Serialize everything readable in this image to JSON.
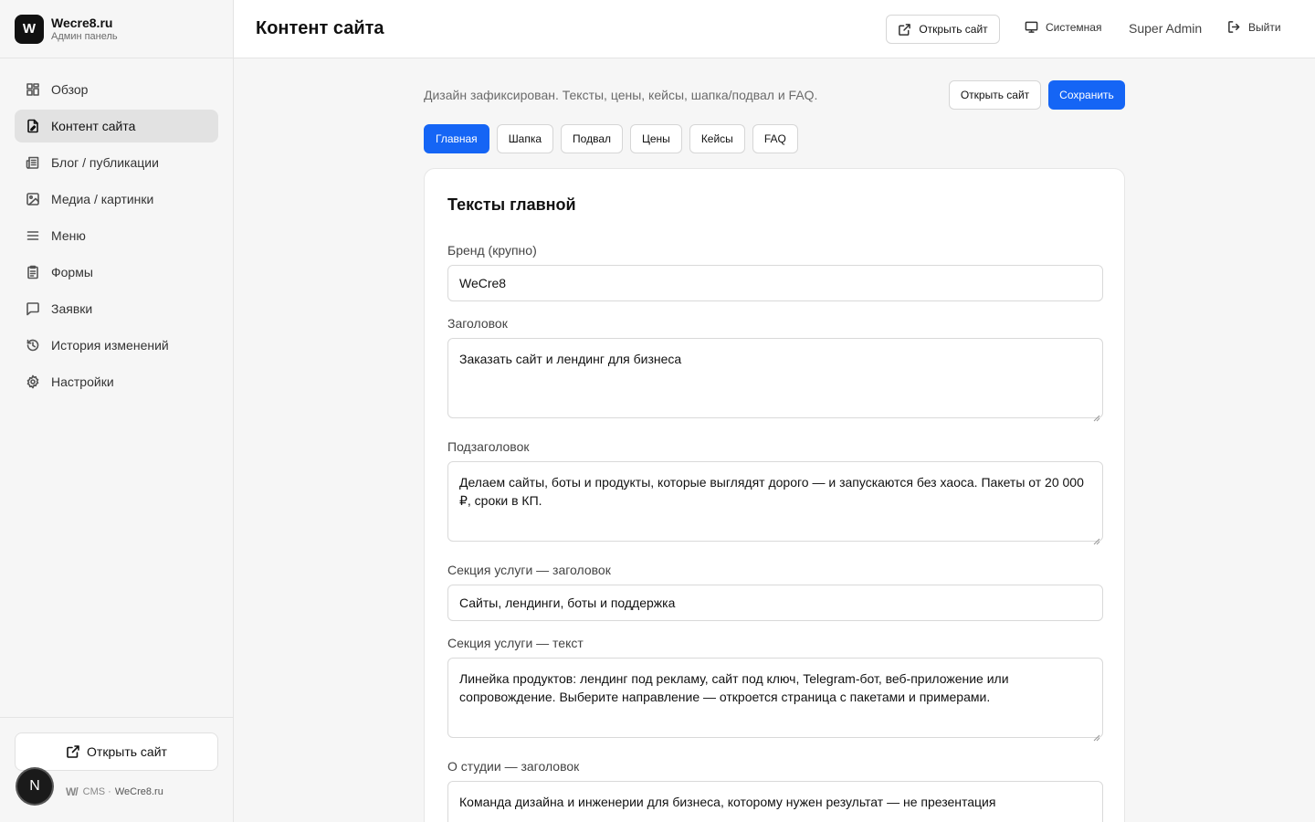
{
  "brand": {
    "logo_letter": "W",
    "name": "Wecre8.ru",
    "subtitle": "Админ панель"
  },
  "nav": [
    {
      "label": "Обзор",
      "icon": "dashboard-icon"
    },
    {
      "label": "Контент сайта",
      "icon": "file-edit-icon",
      "active": true
    },
    {
      "label": "Блог / публикации",
      "icon": "newspaper-icon"
    },
    {
      "label": "Медиа / картинки",
      "icon": "image-icon"
    },
    {
      "label": "Меню",
      "icon": "menu-icon"
    },
    {
      "label": "Формы",
      "icon": "clipboard-icon"
    },
    {
      "label": "Заявки",
      "icon": "message-icon"
    },
    {
      "label": "История изменений",
      "icon": "history-icon"
    },
    {
      "label": "Настройки",
      "icon": "gear-icon"
    }
  ],
  "sidebar_footer": {
    "open_site": "Открыть сайт",
    "cms_label": "CMS ·",
    "cms_site": "WeCre8.ru",
    "badge_letter": "N"
  },
  "header": {
    "title": "Контент сайта",
    "open_site": "Открыть сайт",
    "theme": "Системная",
    "user": "Super Admin",
    "logout": "Выйти"
  },
  "main": {
    "hint": "Дизайн зафиксирован. Тексты, цены, кейсы, шапка/подвал и FAQ.",
    "open_site": "Открыть сайт",
    "save": "Сохранить",
    "tabs": [
      "Главная",
      "Шапка",
      "Подвал",
      "Цены",
      "Кейсы",
      "FAQ"
    ],
    "active_tab": "Главная"
  },
  "card": {
    "title": "Тексты главной",
    "fields": [
      {
        "label": "Бренд (крупно)",
        "value": "WeCre8"
      },
      {
        "label": "Заголовок",
        "value": "Заказать сайт и лендинг для бизнеса"
      },
      {
        "label": "Подзаголовок",
        "value": "Делаем сайты, боты и продукты, которые выглядят дорого — и запускаются без хаоса. Пакеты от 20 000 ₽, сроки в КП."
      },
      {
        "label": "Секция услуги — заголовок",
        "value": "Сайты, лендинги, боты и поддержка"
      },
      {
        "label": "Секция услуги — текст",
        "value": "Линейка продуктов: лендинг под рекламу, сайт под ключ, Telegram-бот, веб-приложение или сопровождение. Выберите направление — откроется страница с пакетами и примерами."
      },
      {
        "label": "О студии — заголовок",
        "value": "Команда дизайна и инженерии для бизнеса, которому нужен результат — не презентация"
      }
    ]
  },
  "colors": {
    "accent": "#1565f5",
    "sidebar_bg": "#f6f6f6",
    "active_nav_bg": "#e2e2e2"
  }
}
